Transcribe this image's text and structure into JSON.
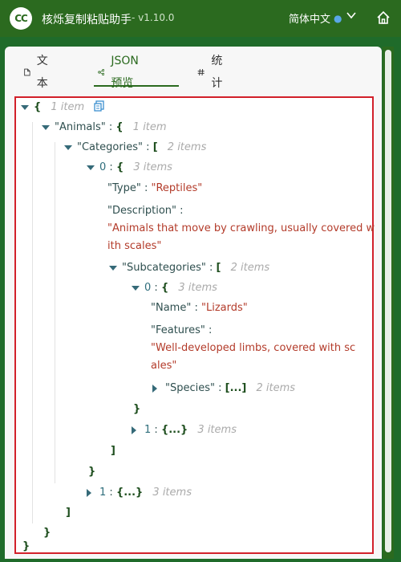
{
  "app": {
    "title": "核烁复制粘贴助手",
    "version": "- v1.10.0",
    "language": "简体中文"
  },
  "icons": {
    "logo": "app-logo",
    "globe": "globe-icon",
    "chevron": "chevron-down-icon",
    "home": "home-icon"
  },
  "logo_text": "CC",
  "tabs": [
    {
      "label": "文本",
      "icon": "document-icon"
    },
    {
      "label": "JSON 预览",
      "icon": "share-icon"
    },
    {
      "label": "统计",
      "icon": "hash-icon"
    }
  ],
  "json_tree": {
    "root_open": "{",
    "root_count": "1 item",
    "animals_key": "\"Animals\"",
    "animals_open": "{",
    "animals_count": "1 item",
    "categories_key": "\"Categories\"",
    "categories_open": "[",
    "categories_count": "2 items",
    "item0_index": "0",
    "item0_open": "{",
    "item0_count": "3 items",
    "type_key": "\"Type\"",
    "type_value": "\"Reptiles\"",
    "desc_key": "\"Description\"",
    "desc_value_line1": "\"Animals that move by crawling, usually covered w",
    "desc_value_line2": "ith scales\"",
    "sub_key": "\"Subcategories\"",
    "sub_open": "[",
    "sub_count": "2 items",
    "sub0_index": "0",
    "sub0_open": "{",
    "sub0_count": "3 items",
    "name_key": "\"Name\"",
    "name_value": "\"Lizards\"",
    "feat_key": "\"Features\"",
    "feat_value_line1": "\"Well-developed limbs, covered with sc",
    "feat_value_line2": "ales\"",
    "species_key": "\"Species\"",
    "species_collapsed": "[...]",
    "species_count": "2 items",
    "sub0_close": "}",
    "sub1_index": "1",
    "sub1_collapsed": "{...}",
    "sub1_count": "3 items",
    "sub_close": "]",
    "item0_close": "}",
    "item1_index": "1",
    "item1_collapsed": "{...}",
    "item1_count": "3 items",
    "categories_close": "]",
    "animals_close": "}",
    "root_close": "}",
    "colon": ":"
  }
}
